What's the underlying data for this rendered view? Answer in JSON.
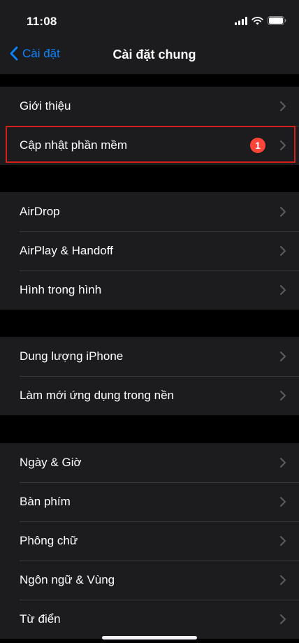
{
  "status_bar": {
    "time": "11:08"
  },
  "nav": {
    "back_label": "Cài đặt",
    "title": "Cài đặt chung"
  },
  "groups": [
    {
      "items": [
        {
          "label": "Giới thiệu"
        },
        {
          "label": "Cập nhật phần mềm",
          "badge": "1"
        }
      ]
    },
    {
      "items": [
        {
          "label": "AirDrop"
        },
        {
          "label": "AirPlay & Handoff"
        },
        {
          "label": "Hình trong hình"
        }
      ]
    },
    {
      "items": [
        {
          "label": "Dung lượng iPhone"
        },
        {
          "label": "Làm mới ứng dụng trong nền"
        }
      ]
    },
    {
      "items": [
        {
          "label": "Ngày & Giờ"
        },
        {
          "label": "Bàn phím"
        },
        {
          "label": "Phông chữ"
        },
        {
          "label": "Ngôn ngữ & Vùng"
        },
        {
          "label": "Từ điển"
        }
      ]
    }
  ],
  "colors": {
    "accent": "#0a84ff",
    "badge": "#ff453a",
    "highlight_border": "#d2201c",
    "cell_background": "#1c1c1e",
    "background": "#000000"
  },
  "icons": {
    "back": "chevron-left-icon",
    "disclosure": "chevron-right-icon",
    "signal": "cellular-signal-icon",
    "wifi": "wifi-icon",
    "battery": "battery-icon"
  }
}
